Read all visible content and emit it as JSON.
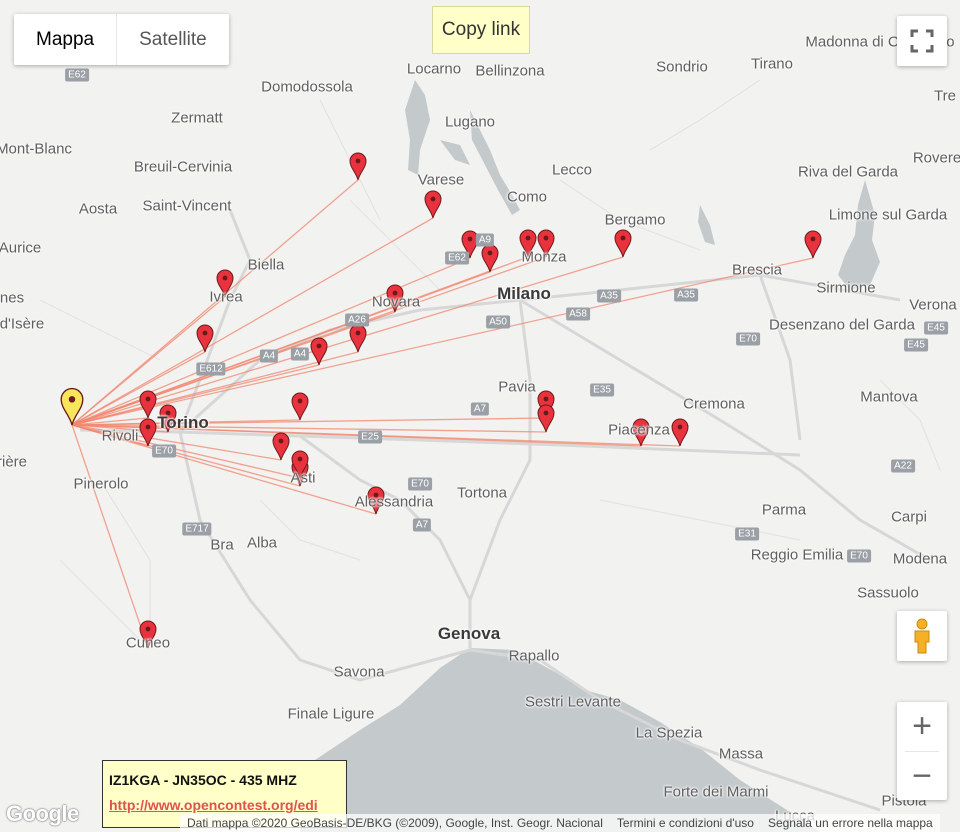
{
  "map_type": {
    "map_label": "Mappa",
    "satellite_label": "Satellite"
  },
  "copy_link_label": "Copy link",
  "icons": {
    "fullscreen": "fullscreen-icon",
    "pegman": "pegman-icon",
    "zoom_in": "plus-icon",
    "zoom_out": "minus-icon",
    "marker": "map-pin-icon"
  },
  "info": {
    "title": "IZ1KGA - JN35OC - 435 MHZ",
    "link": "http://www.opencontest.org/edi"
  },
  "google_logo": "Google",
  "footer": {
    "attribution": "Dati mappa ©2020 GeoBasis-DE/BKG (©2009), Google, Inst. Geogr. Nacional",
    "terms": "Termini e condizioni d'uso",
    "report": "Segnala un errore nella mappa"
  },
  "colors": {
    "line": "#f2866f",
    "marker": "#e8323d",
    "home_marker": "#f7e65c"
  },
  "places": [
    {
      "name": "Locarno",
      "major": false
    },
    {
      "name": "Bellinzona",
      "major": false
    },
    {
      "name": "Sondrio",
      "major": false
    },
    {
      "name": "Tirano",
      "major": false
    },
    {
      "name": "Domodossola",
      "major": false
    },
    {
      "name": "Lugano",
      "major": false
    },
    {
      "name": "Zermatt",
      "major": false
    },
    {
      "name": "Mont-Blanc",
      "major": false
    },
    {
      "name": "Breuil-Cervinia",
      "major": false
    },
    {
      "name": "Varese",
      "major": false
    },
    {
      "name": "Como",
      "major": false
    },
    {
      "name": "Lecco",
      "major": false
    },
    {
      "name": "Riva del Garda",
      "major": false
    },
    {
      "name": "Rovere",
      "major": false
    },
    {
      "name": "Aosta",
      "major": false
    },
    {
      "name": "Saint-Vincent",
      "major": false
    },
    {
      "name": "Bergamo",
      "major": false
    },
    {
      "name": "Limone sul Garda",
      "major": false
    },
    {
      "name": "Biella",
      "major": false
    },
    {
      "name": "Monza",
      "major": false
    },
    {
      "name": "Brescia",
      "major": false
    },
    {
      "name": "Milano",
      "major": true
    },
    {
      "name": "Ivrea",
      "major": false
    },
    {
      "name": "Novara",
      "major": false
    },
    {
      "name": "Sirmione",
      "major": false
    },
    {
      "name": "Verona",
      "major": false
    },
    {
      "name": "Desenzano del Garda",
      "major": false
    },
    {
      "name": "Pavia",
      "major": false
    },
    {
      "name": "Mantova",
      "major": false
    },
    {
      "name": "Cremona",
      "major": false
    },
    {
      "name": "Torino",
      "major": true
    },
    {
      "name": "Rivoli",
      "major": false
    },
    {
      "name": "Piacenza",
      "major": false
    },
    {
      "name": "Asti",
      "major": false
    },
    {
      "name": "Pinerolo",
      "major": false
    },
    {
      "name": "Tortona",
      "major": false
    },
    {
      "name": "Alessandria",
      "major": false
    },
    {
      "name": "Parma",
      "major": false
    },
    {
      "name": "Carpi",
      "major": false
    },
    {
      "name": "Reggio Emilia",
      "major": false
    },
    {
      "name": "Modena",
      "major": false
    },
    {
      "name": "Bra",
      "major": false
    },
    {
      "name": "Alba",
      "major": false
    },
    {
      "name": "Sassuolo",
      "major": false
    },
    {
      "name": "Cuneo",
      "major": false
    },
    {
      "name": "Genova",
      "major": true
    },
    {
      "name": "Rapallo",
      "major": false
    },
    {
      "name": "Savona",
      "major": false
    },
    {
      "name": "Sestri Levante",
      "major": false
    },
    {
      "name": "Finale Ligure",
      "major": false
    },
    {
      "name": "La Spezia",
      "major": false
    },
    {
      "name": "Massa",
      "major": false
    },
    {
      "name": "Forte dei Marmi",
      "major": false
    },
    {
      "name": "Pistoia",
      "major": false
    },
    {
      "name": "Lucca",
      "major": false
    },
    {
      "name": "Madonna di Campiglio",
      "major": false
    },
    {
      "name": "Tre",
      "major": false
    },
    {
      "name": "Aurice",
      "major": false
    },
    {
      "name": "nes",
      "major": false
    },
    {
      "name": "d'Isère",
      "major": false
    },
    {
      "name": "rière",
      "major": false
    }
  ],
  "roads": [
    "E62",
    "A9",
    "E62",
    "A35",
    "A35",
    "A58",
    "A26",
    "A50",
    "E70",
    "E45",
    "A4",
    "E612",
    "E25",
    "A7",
    "E35",
    "A22",
    "E70",
    "A7",
    "E717",
    "E31",
    "E70",
    "E45",
    "E70",
    "A4"
  ]
}
